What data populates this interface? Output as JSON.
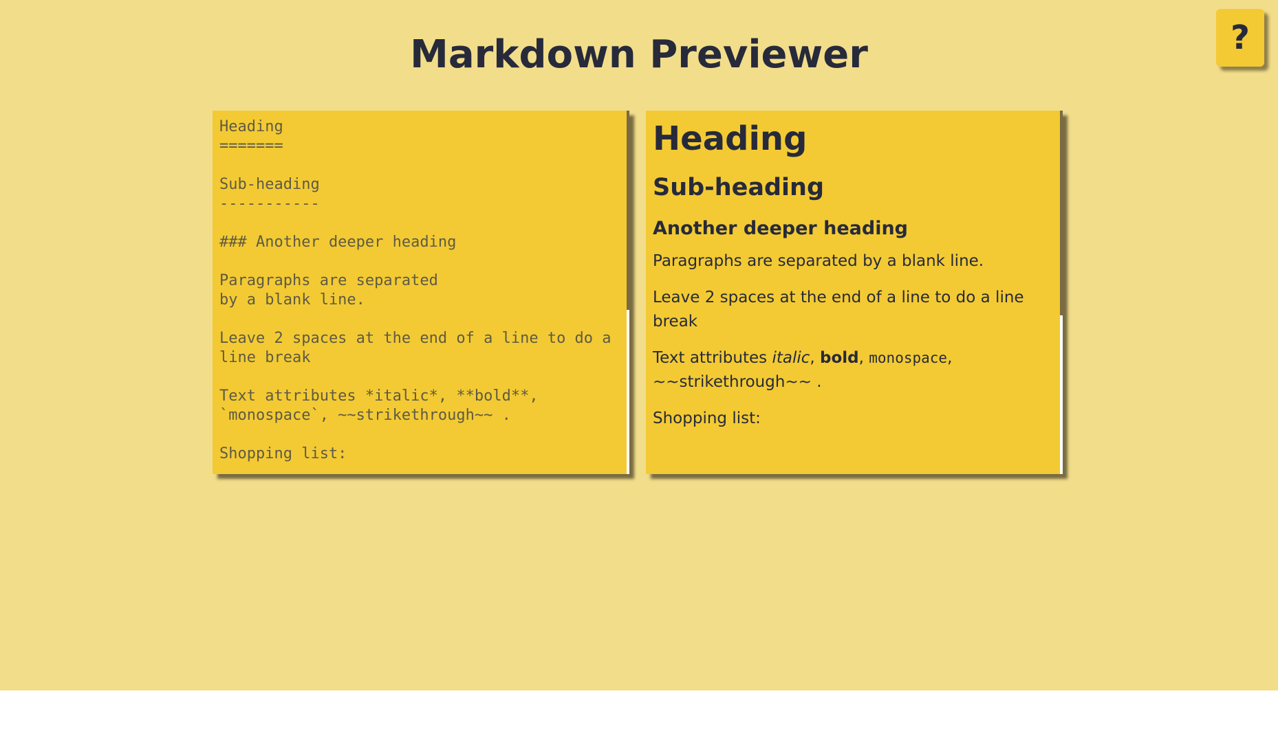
{
  "app": {
    "title": "Markdown Previewer",
    "help_label": "?"
  },
  "editor": {
    "text": "Heading\n=======\n\nSub-heading\n-----------\n\n### Another deeper heading\n\nParagraphs are separated\nby a blank line.\n\nLeave 2 spaces at the end of a line to do a\nline break\n\nText attributes *italic*, **bold**,\n`monospace`, ~~strikethrough~~ .\n\nShopping list:"
  },
  "preview": {
    "h1": "Heading",
    "h2": "Sub-heading",
    "h3": "Another deeper heading",
    "p1": "Paragraphs are separated by a blank line.",
    "p2": "Leave 2 spaces at the end of a line to do a line break",
    "p3_prefix": "Text attributes ",
    "p3_italic": "italic",
    "p3_sep1": ", ",
    "p3_bold": "bold",
    "p3_sep2": ", ",
    "p3_code": "monospace",
    "p3_suffix": ", ~~strikethrough~~ .",
    "p4": "Shopping list:"
  },
  "colors": {
    "page_background": "#f2dd8b",
    "panel_background": "#f3ca33",
    "text_dark": "#272a3a",
    "editor_text": "#5e5a45"
  },
  "icons": {
    "help": "question-mark-icon"
  }
}
